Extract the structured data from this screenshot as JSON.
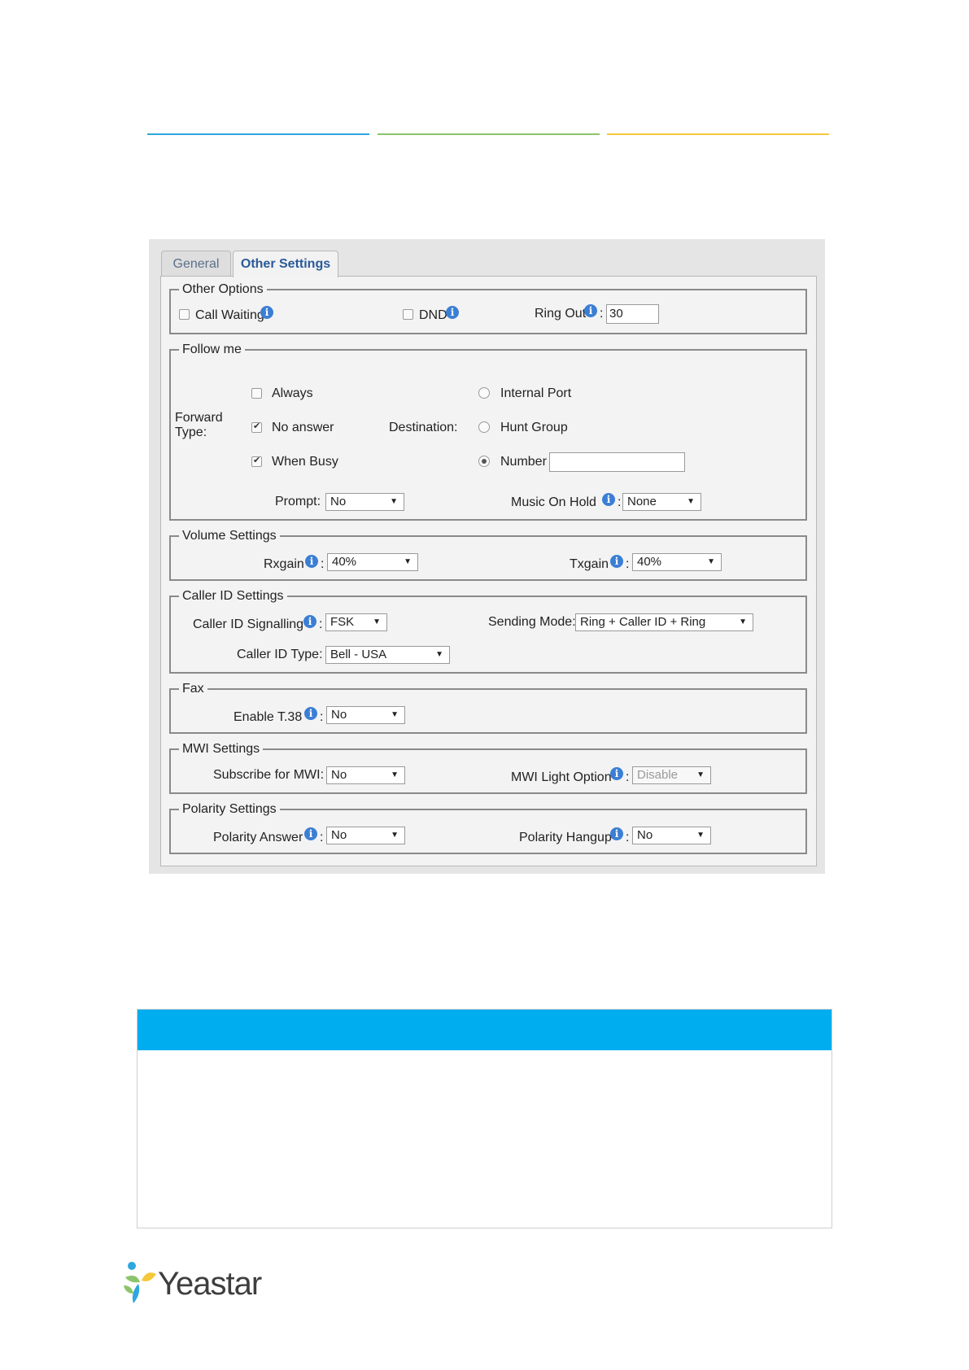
{
  "colors": {
    "line1": "#2ea6de",
    "line2": "#8cc46d",
    "line3": "#f5c83a",
    "header": "#00adef",
    "info": "#3b7fd4"
  },
  "tabs": {
    "general": "General",
    "other": "Other Settings"
  },
  "other_options": {
    "legend": "Other Options",
    "call_waiting": "Call Waiting",
    "dnd": "DND",
    "ring_out": "Ring Out",
    "ring_out_value": "30"
  },
  "follow_me": {
    "legend": "Follow me",
    "forward_type_1": "Forward",
    "forward_type_2": "Type:",
    "always": "Always",
    "no_answer": "No answer",
    "when_busy": "When Busy",
    "destination": "Destination:",
    "internal_port": "Internal Port",
    "hunt_group": "Hunt Group",
    "number": "Number",
    "number_value": "",
    "prompt": "Prompt:",
    "prompt_value": "No",
    "music_on_hold": "Music On Hold",
    "music_on_hold_value": "None"
  },
  "volume": {
    "legend": "Volume Settings",
    "rxgain": "Rxgain",
    "rxgain_value": "40%",
    "txgain": "Txgain",
    "txgain_value": "40%"
  },
  "caller_id": {
    "legend": "Caller ID Settings",
    "signalling": "Caller ID Signalling",
    "signalling_value": "FSK",
    "sending_mode": "Sending Mode:",
    "sending_mode_value": "Ring + Caller ID + Ring",
    "type": "Caller ID Type:",
    "type_value": "Bell - USA"
  },
  "fax": {
    "legend": "Fax",
    "t38": "Enable T.38",
    "t38_value": "No"
  },
  "mwi": {
    "legend": "MWI Settings",
    "subscribe": "Subscribe for MWI:",
    "subscribe_value": "No",
    "light": "MWI Light Option",
    "light_value": "Disable"
  },
  "polarity": {
    "legend": "Polarity Settings",
    "answer": "Polarity Answer",
    "answer_value": "No",
    "hangup": "Polarity Hangup",
    "hangup_value": "No"
  },
  "logo": {
    "text": "Yeastar"
  }
}
